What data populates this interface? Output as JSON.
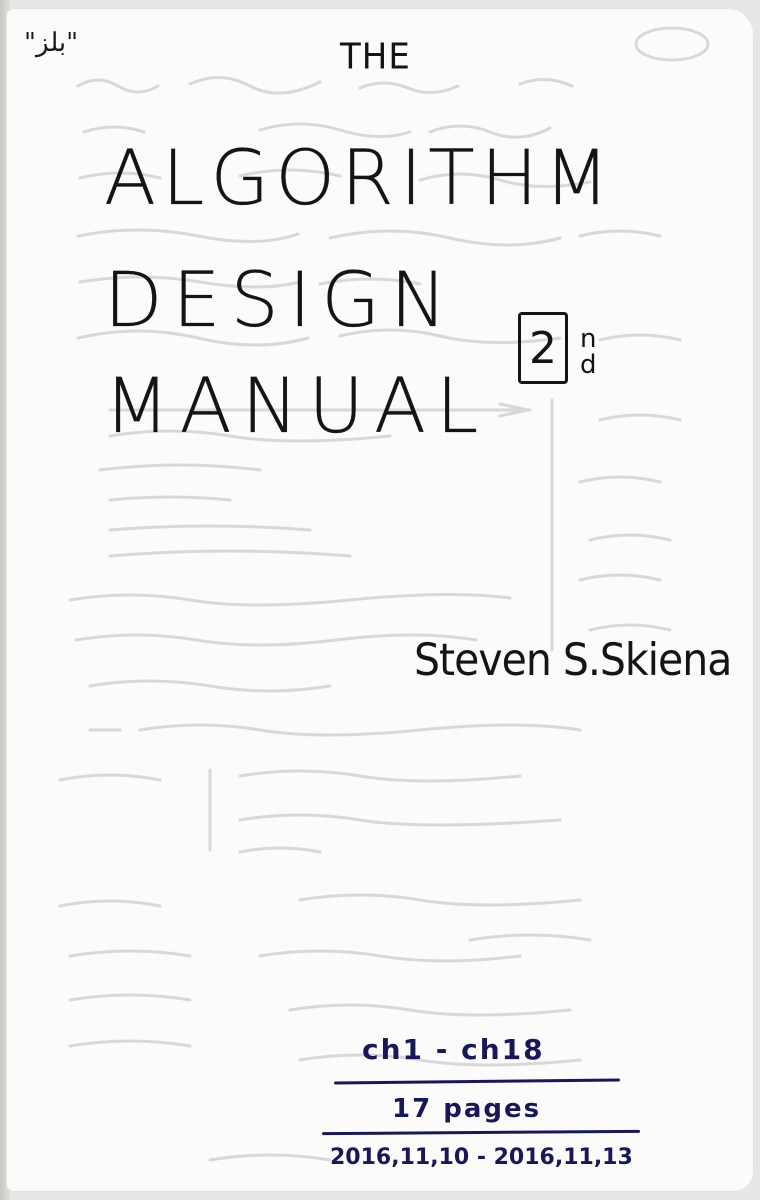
{
  "cover": {
    "corner_mark": "\"بلز\"",
    "title_prefix": "THE",
    "title_lines": [
      "ALGORITHM",
      "DESIGN",
      "MANUAL"
    ],
    "edition_number": "2",
    "edition_suffix": "nd",
    "author": "Steven S.Skiena"
  },
  "notes": {
    "chapter_range": "ch1 - ch18",
    "page_count": "17 pages",
    "date_range": "2016,11,10 - 2016,11,13"
  },
  "colors": {
    "paper": "#fbfbfa",
    "ink_black": "#141414",
    "ink_blue": "#17175e",
    "bleed_through": "#d9d6d8"
  }
}
